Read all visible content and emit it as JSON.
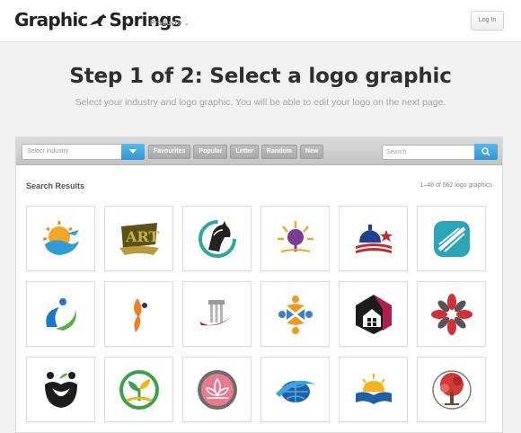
{
  "header": {
    "brand_left": "Graphic",
    "brand_right": "Springs",
    "products_label": "Products",
    "login_label": "Log In"
  },
  "main": {
    "title": "Step 1 of 2: Select a logo graphic",
    "subtitle": "Select your industry and logo graphic. You will be able to edit your logo on the next page."
  },
  "filters": {
    "industry_value": "Select Industry",
    "tabs": [
      "Favourites",
      "Popular",
      "Letter",
      "Random",
      "New"
    ],
    "search_placeholder": "Search"
  },
  "results": {
    "label": "Search Results",
    "count": "1–48 of 562 logo graphics"
  },
  "logos": [
    {
      "icon": "sun-wave-plane-logo"
    },
    {
      "icon": "art-banner-logo"
    },
    {
      "icon": "horse-head-logo"
    },
    {
      "icon": "tree-sunburst-logo"
    },
    {
      "icon": "capitol-flag-logo"
    },
    {
      "icon": "rounded-square-stripes-logo"
    },
    {
      "icon": "swoosh-figure-logo"
    },
    {
      "icon": "flame-figure-logo"
    },
    {
      "icon": "column-swoosh-logo"
    },
    {
      "icon": "four-people-logo"
    },
    {
      "icon": "house-hexagon-logo"
    },
    {
      "icon": "flower-star-logo"
    },
    {
      "icon": "apple-people-logo"
    },
    {
      "icon": "plant-circle-logo"
    },
    {
      "icon": "lotus-circle-logo"
    },
    {
      "icon": "globe-swoosh-logo"
    },
    {
      "icon": "book-sunrise-logo"
    },
    {
      "icon": "red-tree-logo"
    }
  ],
  "colors": {
    "accent_blue": "#3ba3e0",
    "tab_gray": "#b3b3b3"
  }
}
